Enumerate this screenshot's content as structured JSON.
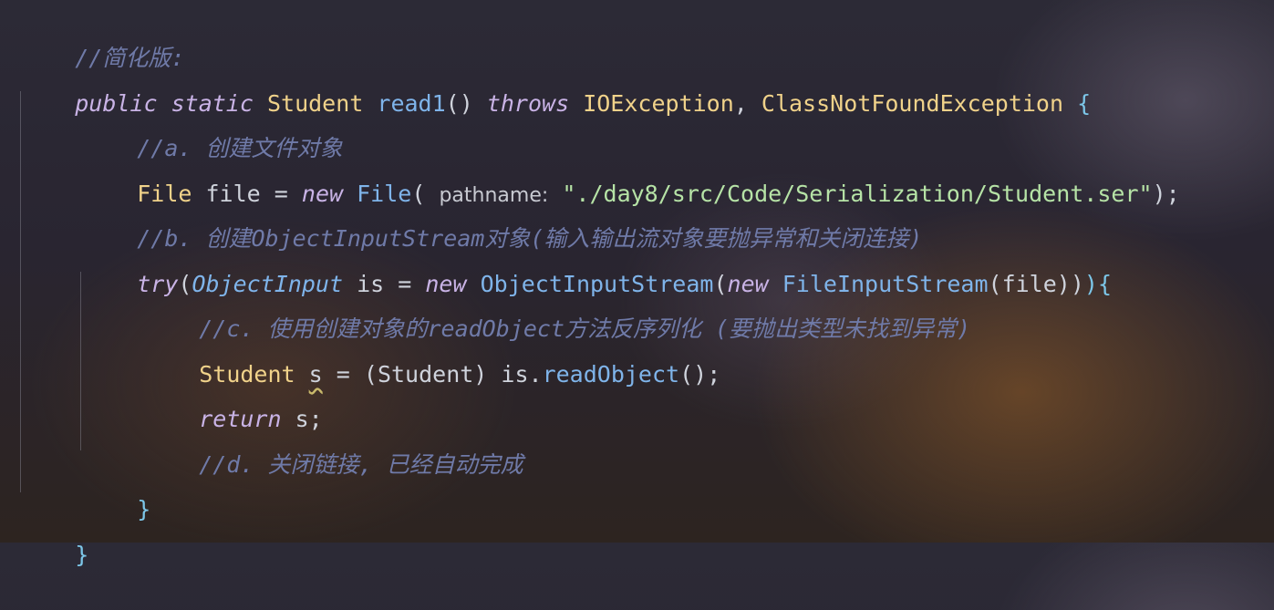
{
  "colors": {
    "comment": "#6f7aa8",
    "keyword": "#c9b3e6",
    "type": "#f0d28a",
    "function": "#7fb4ea",
    "string": "#b6e3a6",
    "text": "#cfd3dc",
    "brace": "#7cc6e8"
  },
  "code": {
    "l1_comment": "//简化版:",
    "l2_public": "public",
    "l2_static": "static",
    "l2_type": "Student",
    "l2_method": "read1",
    "l2_parens": "()",
    "l2_throws": "throws",
    "l2_exc1": "IOException",
    "l2_comma": ",",
    "l2_exc2": "ClassNotFoundException",
    "l2_brace": "{",
    "l3_comment": "//a. 创建文件对象",
    "l4_type": "File",
    "l4_var": "file",
    "l4_eq": "=",
    "l4_new": "new",
    "l4_ctor": "File",
    "l4_paren": "(",
    "l4_hint": "pathname:",
    "l4_string": "\"./day8/src/Code/Serialization/Student.ser\"",
    "l4_end": ");",
    "l5_comment": "//b. 创建ObjectInputStream对象(输入输出流对象要抛异常和关闭连接)",
    "l6_try": "try",
    "l6_paren": "(",
    "l6_iface": "ObjectInput",
    "l6_var": "is",
    "l6_eq": "=",
    "l6_new1": "new",
    "l6_cls1": "ObjectInputStream",
    "l6_paren2": "(",
    "l6_new2": "new",
    "l6_cls2": "FileInputStream",
    "l6_args": "(file))",
    "l6_brace": "){",
    "l7_comment": "//c. 使用创建对象的readObject方法反序列化 (要抛出类型未找到异常)",
    "l8_type": "Student",
    "l8_var": "s",
    "l8_eq": "=",
    "l8_cast": "(Student)",
    "l8_is": "is.",
    "l8_method": "readObject",
    "l8_end": "();",
    "l9_return": "return",
    "l9_rest": "s;",
    "l10_comment": "//d. 关闭链接, 已经自动完成",
    "l11_brace": "}",
    "l12_brace": "}"
  }
}
